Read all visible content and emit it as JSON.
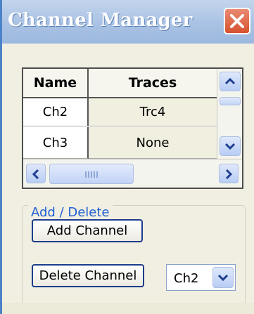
{
  "window": {
    "title": "Channel Manager"
  },
  "table": {
    "columns": [
      "Name",
      "Traces"
    ],
    "rows": [
      {
        "name": "Ch2",
        "traces": "Trc4"
      },
      {
        "name": "Ch3",
        "traces": "None"
      }
    ]
  },
  "group": {
    "legend": "Add / Delete",
    "add_label": "Add Channel",
    "delete_label": "Delete Channel",
    "selected_channel": "Ch2"
  },
  "icons": {
    "close": "close-icon",
    "scroll_up": "chevron-up-icon",
    "scroll_down": "chevron-down-icon",
    "scroll_left": "chevron-left-icon",
    "scroll_right": "chevron-right-icon",
    "dropdown": "chevron-down-icon"
  },
  "colors": {
    "titlebar": "#a9c2e4",
    "close": "#d6522f",
    "legend_text": "#1f5fd3",
    "button_border": "#1c3d8c"
  }
}
